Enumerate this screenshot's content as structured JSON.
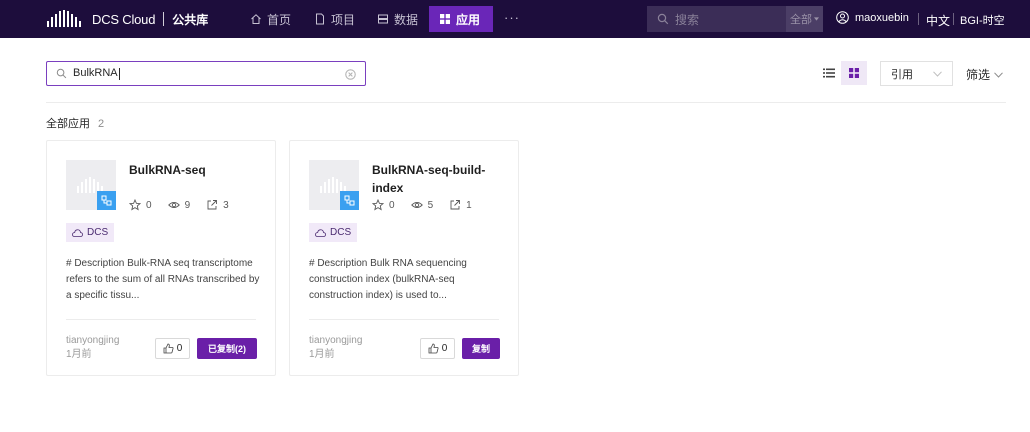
{
  "nav": {
    "brand": "DCS Cloud",
    "sub_brand": "公共库",
    "items": [
      {
        "label": "首页",
        "icon": "home-icon"
      },
      {
        "label": "项目",
        "icon": "file-icon"
      },
      {
        "label": "数据",
        "icon": "database-icon"
      },
      {
        "label": "应用",
        "icon": "grid-icon",
        "active": true
      }
    ],
    "more": "···",
    "search_placeholder": "搜索",
    "search_scope": "全部",
    "username": "maoxuebin",
    "language": "中文",
    "org": "BGI-时空"
  },
  "toolbar": {
    "search_value": "BulkRNA",
    "sort_label": "引用",
    "filter_label": "筛选"
  },
  "summary": {
    "label": "全部应用",
    "count": "2"
  },
  "cards": [
    {
      "title": "BulkRNA-seq",
      "stars": "0",
      "views": "9",
      "refs": "3",
      "tag": "DCS",
      "description": "# Description Bulk-RNA seq transcriptome refers to the sum of all RNAs transcribed by a specific tissu...",
      "author": "tianyongjing",
      "time": "1月前",
      "likes": "0",
      "copy_label": "已复制(2)"
    },
    {
      "title": "BulkRNA-seq-build-index",
      "stars": "0",
      "views": "5",
      "refs": "1",
      "tag": "DCS",
      "description": "# Description Bulk RNA sequencing construction index (bulkRNA-seq construction index) is used to...",
      "author": "tianyongjing",
      "time": "1月前",
      "likes": "0",
      "copy_label": "复制"
    }
  ],
  "colors": {
    "nav_bg": "#1d0d3c",
    "accent": "#6a26b8",
    "button": "#6a1fa8",
    "badge_blue": "#3aa0f0"
  }
}
